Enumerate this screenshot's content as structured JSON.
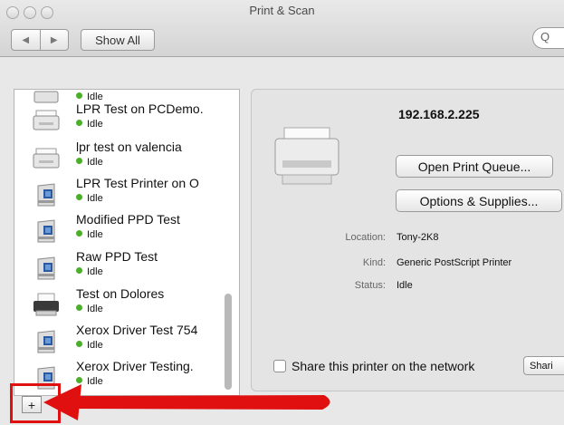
{
  "window": {
    "title": "Print & Scan"
  },
  "toolbar": {
    "back_glyph": "◀",
    "forward_glyph": "▶",
    "show_all_label": "Show All",
    "search_glyph": "Q"
  },
  "printers": [
    {
      "name": "",
      "status": "Idle",
      "icon": "generic-printer-icon",
      "partial": true
    },
    {
      "name": "LPR Test on PCDemo.",
      "status": "Idle",
      "icon": "generic-printer-icon"
    },
    {
      "name": "lpr test on valencia",
      "status": "Idle",
      "icon": "generic-printer-icon"
    },
    {
      "name": "LPR Test Printer on O",
      "status": "Idle",
      "icon": "xerox-printer-icon"
    },
    {
      "name": "Modified PPD Test",
      "status": "Idle",
      "icon": "xerox-printer-icon"
    },
    {
      "name": "Raw PPD Test",
      "status": "Idle",
      "icon": "xerox-printer-icon"
    },
    {
      "name": "Test on Dolores",
      "status": "Idle",
      "icon": "inkjet-printer-icon"
    },
    {
      "name": "Xerox Driver Test 754",
      "status": "Idle",
      "icon": "xerox-printer-icon"
    },
    {
      "name": "Xerox Driver Testing.",
      "status": "Idle",
      "icon": "xerox-printer-icon"
    }
  ],
  "list_controls": {
    "add_label": "+"
  },
  "detail": {
    "printer_address": "192.168.2.225",
    "open_queue_label": "Open Print Queue...",
    "options_label": "Options & Supplies...",
    "location_label": "Location:",
    "location_value": "Tony-2K8",
    "kind_label": "Kind:",
    "kind_value": "Generic PostScript Printer",
    "status_label": "Status:",
    "status_value": "Idle",
    "share_label": "Share this printer on the network",
    "share_checked": false,
    "sharing_button_label": "Shari"
  },
  "annotation": {
    "color": "#e01010"
  }
}
